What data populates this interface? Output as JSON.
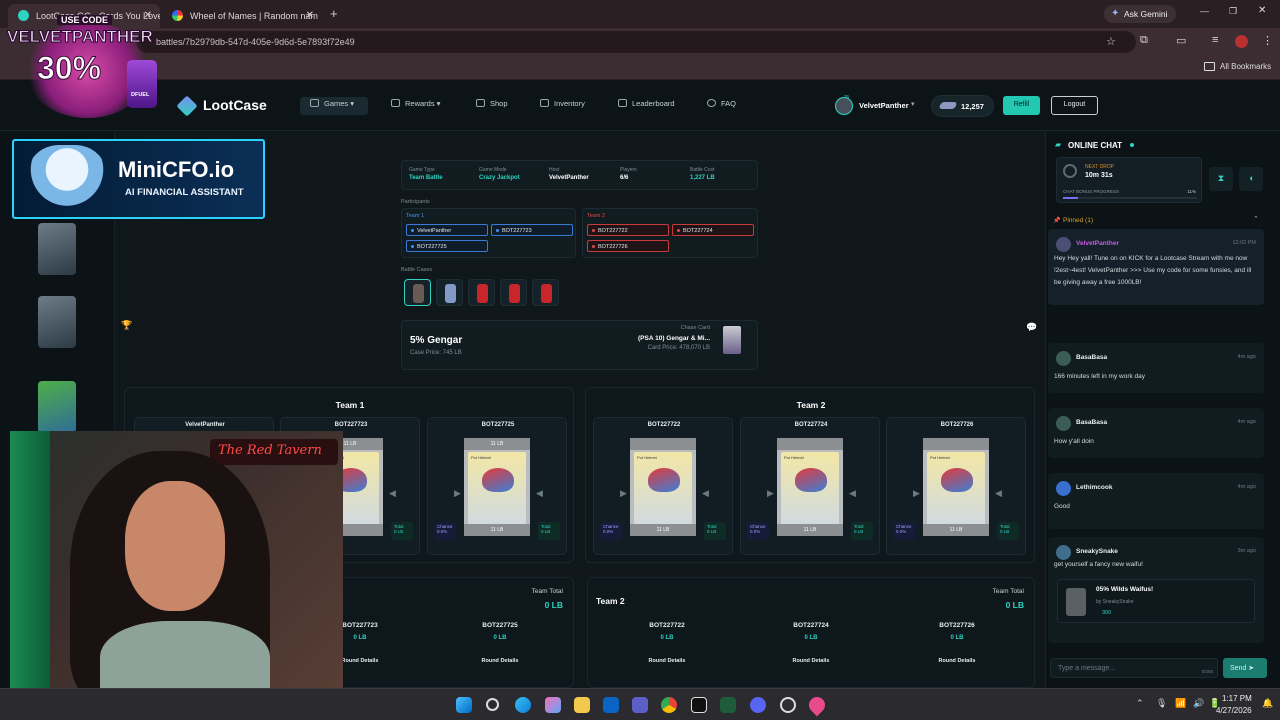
{
  "browser": {
    "tabs": [
      {
        "label": "LootCase.GG - Cards You Love"
      },
      {
        "label": "Wheel of Names | Random nam"
      }
    ],
    "new_tab": "+",
    "gemini": "Ask Gemini",
    "url": "battles/7b2979db-547d-405e-9d6d-5e7893f72e49",
    "bookmarks": "All Bookmarks"
  },
  "site": {
    "brand": "LootCase",
    "nav": [
      "Games",
      "Rewards",
      "Shop",
      "Inventory",
      "Leaderboard",
      "FAQ"
    ],
    "user": {
      "name": "VelvetPanther",
      "level": "35",
      "balance": "12,257"
    },
    "refill": "Refill",
    "logout": "Logout"
  },
  "battle": {
    "info": [
      {
        "label": "Game Type",
        "value": "Team Battle"
      },
      {
        "label": "Game Mode",
        "value": "Crazy Jackpot"
      },
      {
        "label": "Host",
        "value": "VelvetPanther"
      },
      {
        "label": "Players",
        "value": "6/6"
      },
      {
        "label": "Battle Cost",
        "value": "1,227 LB"
      }
    ],
    "participants_label": "Participants",
    "team1_label": "Team 1",
    "team2_label": "Team 2",
    "team1": [
      "VelvetPanther",
      "BOT227723",
      "BOT227725"
    ],
    "team2": [
      "BOT227722",
      "BOT227724",
      "BOT227726"
    ],
    "cases_label": "Battle Cases",
    "current_case": {
      "name": "5% Gengar",
      "price": "Case Price: 745 LB"
    },
    "chase": {
      "label": "Chase Card",
      "name": "(PSA 10) Gengar & Mi...",
      "price": "Card Price: 478,070 LB"
    }
  },
  "arena": {
    "team1_title": "Team 1",
    "team2_title": "Team 2",
    "slots": [
      {
        "name": "VelvetPanther",
        "top": "",
        "bottom": ""
      },
      {
        "name": "BOT227723",
        "top": "11 LB",
        "bottom": ""
      },
      {
        "name": "BOT227725",
        "top": "11 LB",
        "bottom": "11 LB"
      },
      {
        "name": "BOT227722",
        "top": "",
        "bottom": "11 LB"
      },
      {
        "name": "BOT227724",
        "top": "",
        "bottom": "11 LB"
      },
      {
        "name": "BOT227726",
        "top": "",
        "bottom": "11 LB"
      }
    ],
    "card_title": "Pot Helmet",
    "chance_label": "Chance",
    "chance_value": "0.0%",
    "total_label": "Total",
    "total_value": "0 LB"
  },
  "summary": {
    "team_total_label": "Team Total",
    "team1_total": "0 LB",
    "team2_title": "Team 2",
    "team2_total": "0 LB",
    "team1_players": [
      {
        "name": "BOT227723",
        "value": "0 LB"
      },
      {
        "name": "BOT227725",
        "value": "0 LB"
      }
    ],
    "team2_players": [
      {
        "name": "BOT227722",
        "value": "0 LB"
      },
      {
        "name": "BOT227724",
        "value": "0 LB"
      },
      {
        "name": "BOT227726",
        "value": "0 LB"
      }
    ],
    "round_details": "Round Details"
  },
  "chat": {
    "title": "ONLINE CHAT",
    "next_drop_label": "NEXT DROP",
    "next_drop": "10m 31s",
    "bonus_label": "CHAT BONUS PROGRESS",
    "bonus_pct": "11%",
    "bonus_fraction": 0.11,
    "pinned": "Pinned (1)",
    "pinned_msg": {
      "user": "VelvetPanther",
      "time": "12:02 PM",
      "text": "Hey Hey yall! Tune on on KICK for a Lootcase Stream with me now !2est~4est! VelvetPanther >>> Use my code for some funsies, and ill be giving away a free 1000LB!"
    },
    "messages": [
      {
        "user": "BasaBasa",
        "time": "4m ago",
        "text": "166 minutes left in my work day"
      },
      {
        "user": "BasaBasa",
        "time": "4m ago",
        "text": "How y'all doin"
      },
      {
        "user": "Lethimcook",
        "time": "4m ago",
        "text": "Good"
      },
      {
        "user": "SneakySnake",
        "time": "3m ago",
        "text": "get yourself a fancy new waifu!"
      }
    ],
    "shared_case": {
      "name": "05% Wilds Waifus!",
      "by": "by SneakySnake",
      "price": "300"
    },
    "input_placeholder": "Type a message...",
    "char_count": "0/250",
    "send": "Send"
  },
  "overlays": {
    "promo_top": "USE CODE",
    "promo_code": "VELVETPANTHER",
    "promo_pct": "30%",
    "promo_brand": "DFUEL",
    "mini_title": "MiniCFO.io",
    "mini_sub": "AI FINANCIAL ASSISTANT",
    "cam_sign": "The Red Tavern"
  },
  "taskbar": {
    "time": "1:17 PM",
    "date": "4/27/2026"
  }
}
